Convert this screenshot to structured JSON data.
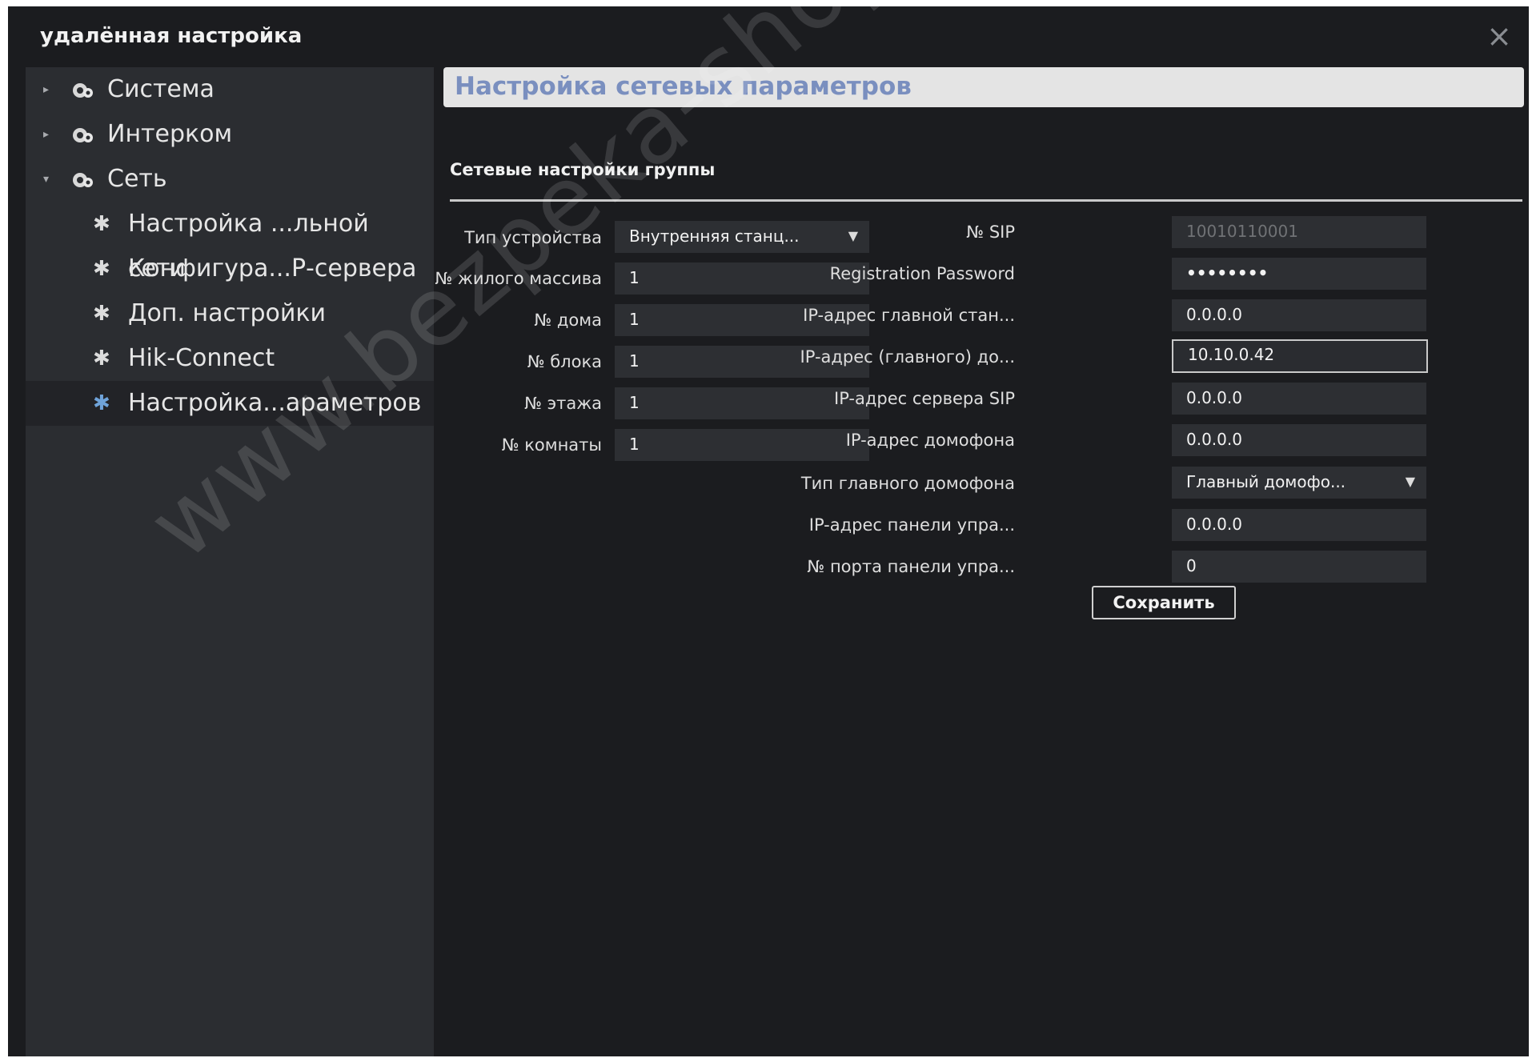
{
  "window": {
    "title": "удалённая настройка",
    "close_icon": "×"
  },
  "sidebar": {
    "groups": [
      {
        "label": "Система",
        "expanded": false
      },
      {
        "label": "Интерком",
        "expanded": false
      },
      {
        "label": "Сеть",
        "expanded": true
      }
    ],
    "items": [
      {
        "label": "Настройка ...льной сети"
      },
      {
        "label": "Конфигура...Р-сервера"
      },
      {
        "label": "Доп. настройки"
      },
      {
        "label": "Hik-Connect"
      },
      {
        "label": "Настройка...араметров",
        "selected": true
      }
    ]
  },
  "main": {
    "header": "Настройка сетевых параметров",
    "group_title": "Сетевые настройки группы",
    "left_fields": [
      {
        "label": "Тип устройства",
        "value": "Внутренняя станц...",
        "type": "dropdown"
      },
      {
        "label": "№ жилого массива",
        "value": "1"
      },
      {
        "label": "№ дома",
        "value": "1"
      },
      {
        "label": "№ блока",
        "value": "1"
      },
      {
        "label": "№ этажа",
        "value": "1"
      },
      {
        "label": "№ комнаты",
        "value": "1"
      }
    ],
    "right_fields": [
      {
        "label": "№ SIP",
        "value": "10010110001",
        "disabled": true
      },
      {
        "label": "Registration Password",
        "value": "••••••••"
      },
      {
        "label": "IP-адрес главной стан...",
        "value": "0.0.0.0"
      },
      {
        "label": "IP-адрес (главного) до...",
        "value": "10.10.0.42",
        "active": true
      },
      {
        "label": "IP-адрес сервера SIP",
        "value": "0.0.0.0"
      },
      {
        "label": "IP-адрес домофона",
        "value": "0.0.0.0"
      },
      {
        "label": "Тип главного домофона",
        "value": "Главный домофо...",
        "type": "dropdown"
      },
      {
        "label": "IP-адрес панели упра...",
        "value": "0.0.0.0"
      },
      {
        "label": "№ порта панели упра...",
        "value": "0"
      }
    ],
    "save_label": "Сохранить"
  },
  "watermark": "www.bezpeka-shop.com",
  "colors": {
    "background": "#1b1c1f",
    "sidebar": "#2b2d31",
    "field": "#2d2f33",
    "header_text": "#7a8fbf",
    "accent_gear": "#6fa3d9"
  }
}
